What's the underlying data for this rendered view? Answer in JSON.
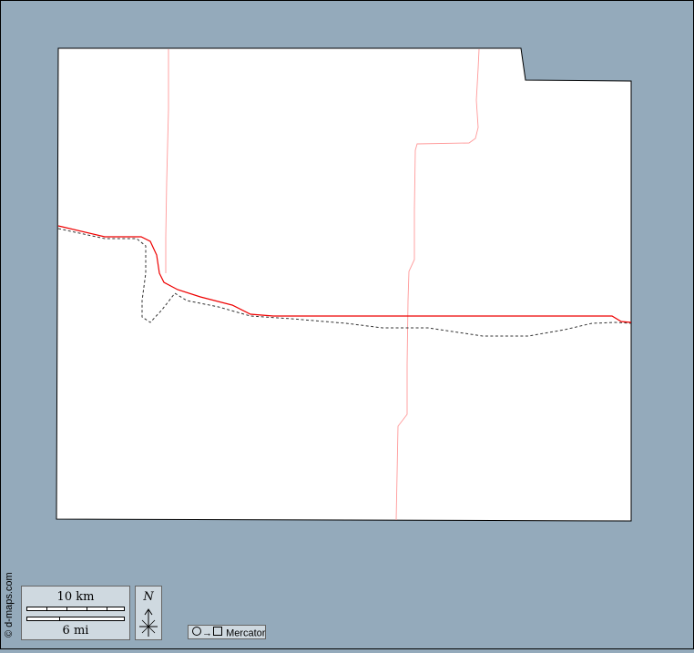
{
  "map": {
    "sea_color": "#94aabb",
    "land_color": "#ffffff",
    "boundary_color": "#000000",
    "road_color": "#ff0000",
    "minor_road_color": "#ff9999",
    "railroad_style": "dashed"
  },
  "credit": "© d-maps.com",
  "scale": {
    "km_label": "10 km",
    "mi_label": "6 mi"
  },
  "north": {
    "label": "N"
  },
  "projection": {
    "label": "Mercator",
    "icon": "circle-to-square-icon",
    "arrow": "→"
  }
}
